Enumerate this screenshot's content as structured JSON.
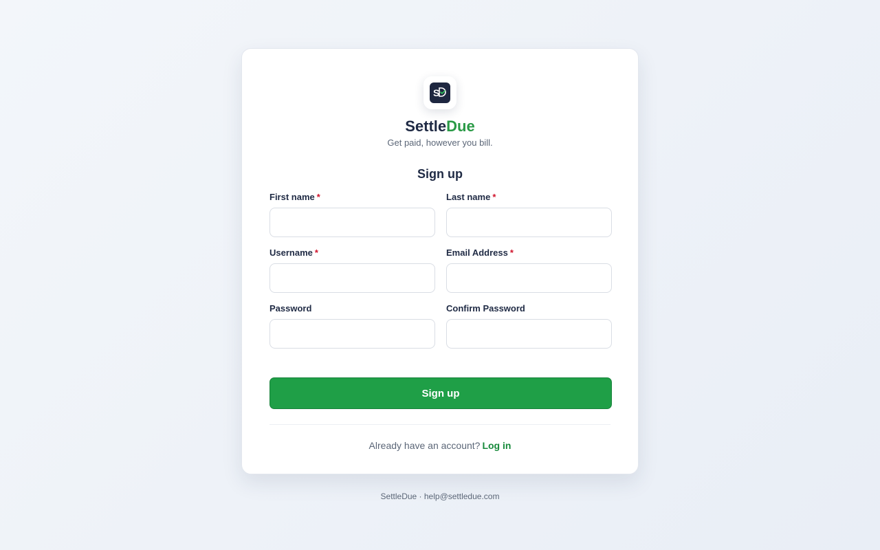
{
  "brand": {
    "logo_icon": "sd-monogram-icon",
    "name_primary": "Settle",
    "name_accent": "Due",
    "tagline": "Get paid, however you bill.",
    "accent_color": "#2a9a46"
  },
  "form": {
    "title": "Sign up",
    "fields": {
      "first_name": {
        "label": "First name",
        "required_mark": "*",
        "value": "",
        "placeholder": ""
      },
      "last_name": {
        "label": "Last name",
        "required_mark": "*",
        "value": "",
        "placeholder": ""
      },
      "username": {
        "label": "Username",
        "required_mark": "*",
        "value": "",
        "placeholder": ""
      },
      "email": {
        "label": "Email Address",
        "required_mark": "*",
        "value": "",
        "placeholder": ""
      },
      "password": {
        "label": "Password",
        "value": "",
        "placeholder": ""
      },
      "confirm_password": {
        "label": "Confirm Password",
        "value": "",
        "placeholder": ""
      }
    },
    "submit_label": "Sign up",
    "submit_color": "#1f9f47"
  },
  "login_prompt": {
    "text": "Already have an account?",
    "link_label": "Log in"
  },
  "footer": {
    "text": "SettleDue · help@settledue.com"
  }
}
